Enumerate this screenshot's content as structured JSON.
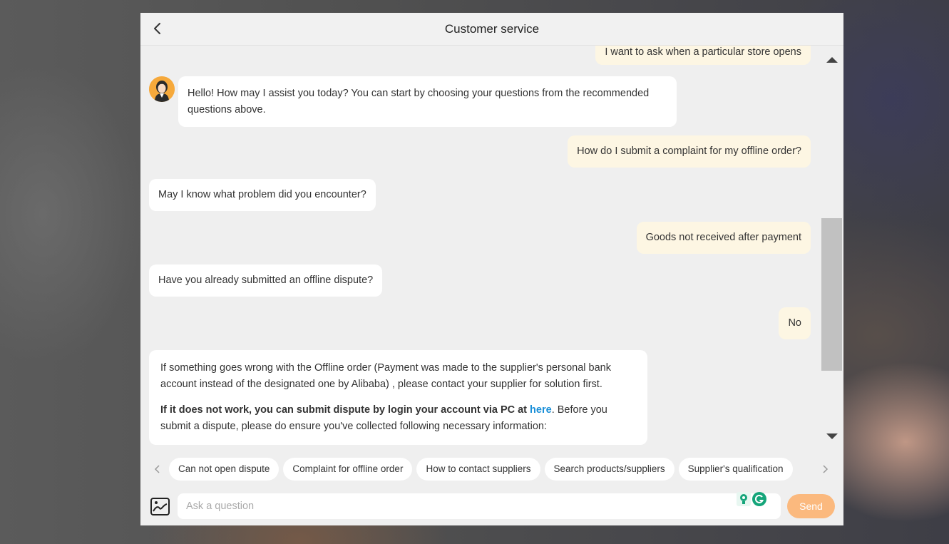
{
  "header": {
    "title": "Customer service"
  },
  "messages": [
    {
      "role": "user",
      "text": "I want to ask when a particular store opens"
    },
    {
      "role": "bot",
      "text": "Hello! How may I assist you today? You can start by choosing your questions from the recommended questions above."
    },
    {
      "role": "user",
      "text": "How do I submit a complaint for my offline order?"
    },
    {
      "role": "bot",
      "text": "May I know what problem did you encounter?"
    },
    {
      "role": "user",
      "text": "Goods not received after payment"
    },
    {
      "role": "bot",
      "text": "Have you already submitted an offline dispute?"
    },
    {
      "role": "user",
      "text": "No"
    },
    {
      "role": "bot",
      "paragraph1": "If something goes wrong with the Offline order (Payment was made to the supplier's personal bank account instead of the designated one by Alibaba) , please contact your supplier for solution first.",
      "bold_text": "If it does not work, you can submit dispute by login your account via PC at ",
      "link_text": "here",
      "after_link": ". Before you submit a dispute, please do ensure you've collected following necessary information:"
    }
  ],
  "quick_questions": [
    "Can not open dispute",
    "Complaint for offline order",
    "How to contact suppliers",
    "Search products/suppliers",
    "Supplier's qualification"
  ],
  "input": {
    "placeholder": "Ask a question",
    "value": ""
  },
  "send_label": "Send",
  "colors": {
    "user_bubble": "#fdf6e3",
    "bot_bubble": "#ffffff",
    "send_button": "#fbb97e",
    "link": "#1a8fd8",
    "avatar_bg": "#f6a93b"
  }
}
